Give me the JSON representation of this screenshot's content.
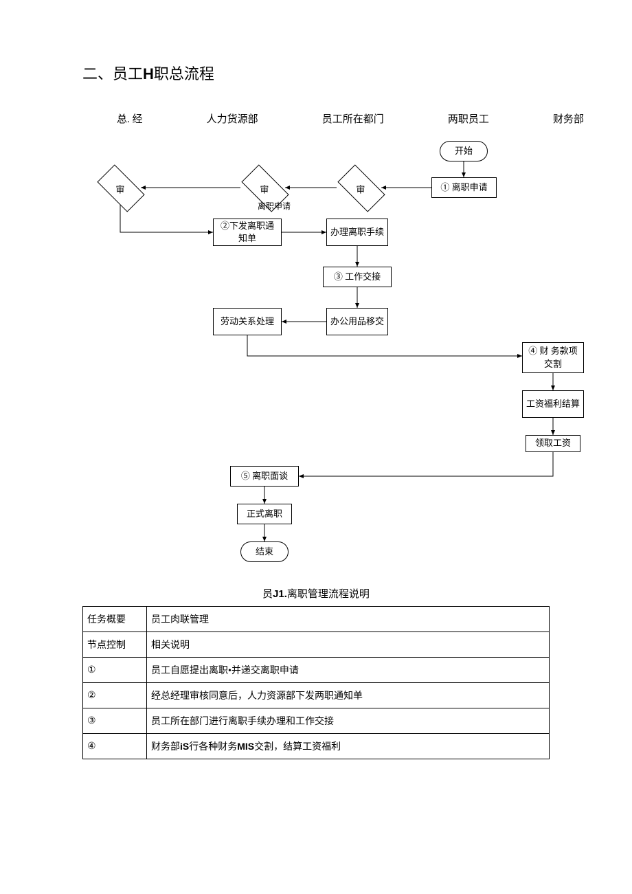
{
  "title_prefix": "二、员工",
  "title_latin": "H",
  "title_suffix": "职总流程",
  "lanes": {
    "l1": "总. 经",
    "l2": "人力货源部",
    "l3": "员工所在都门",
    "l4": "两职员工",
    "l5": "财务部"
  },
  "nodes": {
    "start": "开始",
    "apply": "① 离职申请",
    "rev1": "审",
    "rev2": "审",
    "rev3": "审",
    "apply_lbl": "离职申请",
    "notice": "②下发离职通知单",
    "handle": "办理离职手续",
    "handover": "③ 工作交接",
    "labor": "劳动关系处理",
    "supplies": "办公用品移交",
    "finance": "④ 财 务款项交割",
    "salary": "工资福利结算",
    "collect": "领取工资",
    "interview": "⑤ 离职面谈",
    "formal": "正式离职",
    "end": "结束"
  },
  "caption_prefix": "员",
  "caption_bold": "J1.",
  "caption_suffix": "离职管理流程说明",
  "table": {
    "r1k": "任务概要",
    "r1v": "员工肉联管理",
    "r2k": "节点控制",
    "r2v": "相关说明",
    "r3k": "①",
    "r3v": "员工自愿提出离职•并递交离职申请",
    "r4k": "②",
    "r4v": "经总经理审核同意后，人力资源部下发两职通知单",
    "r5k": "③",
    "r5v": "员工所在部门进行离职手续办理和工作交接",
    "r6k": "④",
    "r6v_a": "财务部",
    "r6v_b": "iS",
    "r6v_c": "行各种财务",
    "r6v_d": "MIS",
    "r6v_e": "交割，结算工资福利"
  }
}
